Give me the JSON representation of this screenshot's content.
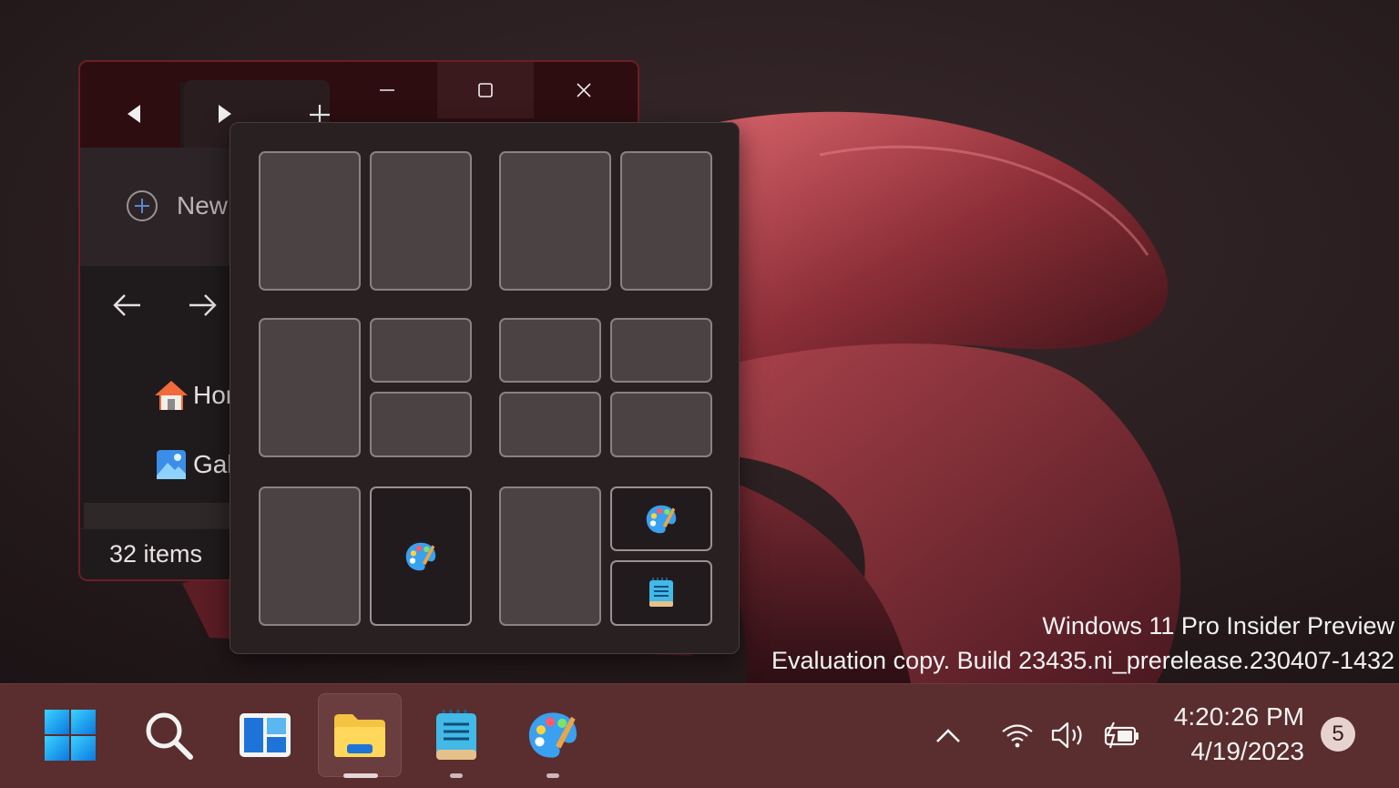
{
  "wallpaper": {
    "colors": {
      "base": "#1d1416",
      "bloom": "#7a2a33",
      "highlight": "#d4646b"
    }
  },
  "explorer": {
    "title_buttons": {
      "minimize": "minimize-icon",
      "maximize": "maximize-icon",
      "close": "close-icon"
    },
    "tab_nav": {
      "back": "triangle-left-icon",
      "forward": "triangle-right-icon",
      "new_tab": "plus-icon"
    },
    "toolbar": {
      "new_label": "New"
    },
    "nav": {
      "back": "arrow-left-icon",
      "forward": "arrow-right-icon"
    },
    "sidebar": [
      {
        "label": "Hor",
        "icon": "home-icon"
      },
      {
        "label": "Gal",
        "icon": "gallery-icon"
      }
    ],
    "status": {
      "items": "32 items"
    }
  },
  "snap_layouts": {
    "layouts": [
      {
        "name": "two-equal",
        "zones": 2
      },
      {
        "name": "two-wide-narrow",
        "zones": 2
      },
      {
        "name": "one-left-two-right",
        "zones": 3
      },
      {
        "name": "four-grid",
        "zones": 4
      },
      {
        "name": "two-equal-paint",
        "zones": 2,
        "filled_icons": [
          "paint-icon"
        ]
      },
      {
        "name": "one-left-two-right-apps",
        "zones": 3,
        "filled_icons": [
          "paint-icon",
          "notepad-icon"
        ]
      }
    ]
  },
  "watermark": {
    "line1": "Windows 11 Pro Insider Preview",
    "line2": "Evaluation copy. Build 23435.ni_prerelease.230407-1432"
  },
  "taskbar": {
    "apps": [
      {
        "name": "Start",
        "icon": "windows-logo-icon"
      },
      {
        "name": "Search",
        "icon": "search-icon"
      },
      {
        "name": "Widgets",
        "icon": "widgets-icon"
      },
      {
        "name": "File Explorer",
        "icon": "folder-icon",
        "active": true
      },
      {
        "name": "Notepad",
        "icon": "notepad-icon"
      },
      {
        "name": "Paint",
        "icon": "paint-icon"
      }
    ],
    "tray": {
      "chevron": "chevron-up-icon",
      "wifi": "wifi-icon",
      "volume": "volume-icon",
      "battery": "battery-charging-icon"
    },
    "clock": {
      "time": "4:20:26 PM",
      "date": "4/19/2023"
    },
    "notification_count": "5"
  }
}
